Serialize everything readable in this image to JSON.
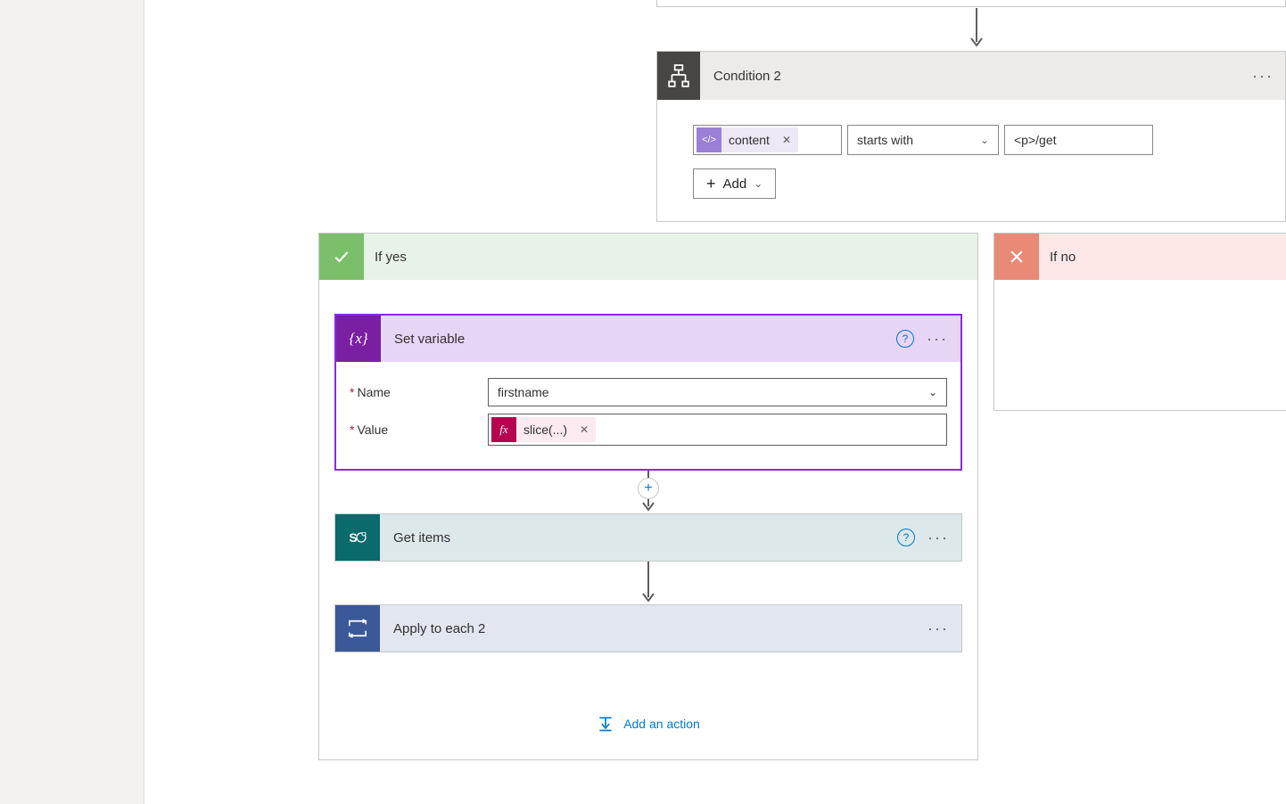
{
  "condition": {
    "title": "Condition 2",
    "left_pill": "content",
    "operator": "starts with",
    "value": "<p>/get",
    "add_label": "Add"
  },
  "branches": {
    "yes_label": "If yes",
    "no_label": "If no"
  },
  "set_variable": {
    "title": "Set variable",
    "icon_text": "{x}",
    "name_label": "Name",
    "name_value": "firstname",
    "value_label": "Value",
    "fx_label": "slice(...)"
  },
  "get_items": {
    "title": "Get items",
    "icon_text": "S"
  },
  "apply_each": {
    "title": "Apply to each 2"
  },
  "common": {
    "add_action": "Add an action"
  }
}
